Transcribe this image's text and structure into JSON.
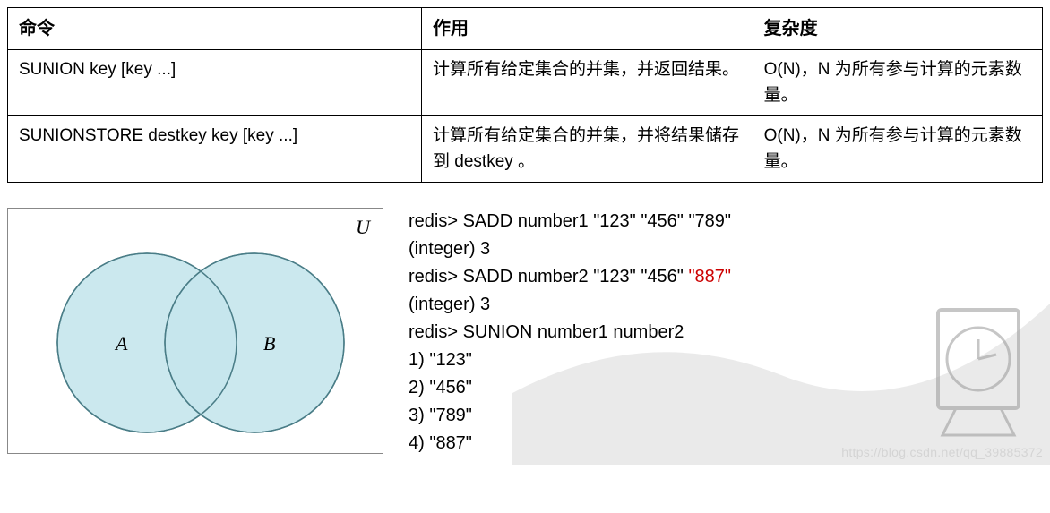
{
  "table": {
    "headers": [
      "命令",
      "作用",
      "复杂度"
    ],
    "rows": [
      {
        "cmd": "SUNION key [key ...]",
        "desc": "计算所有给定集合的并集，并返回结果。",
        "complexity": "O(N)，N 为所有参与计算的元素数量。"
      },
      {
        "cmd": "SUNIONSTORE destkey key [key ...]",
        "desc": "计算所有给定集合的并集，并将结果储存到 destkey 。",
        "complexity": "O(N)，N 为所有参与计算的元素数量。"
      }
    ]
  },
  "venn": {
    "U": "U",
    "A": "A",
    "B": "B"
  },
  "code": {
    "l1_prefix": "redis> SADD number1 \"123\" \"456\" \"789\"",
    "l2": "(integer) 3",
    "l3_prefix": "redis> SADD number2 \"123\" \"456\" ",
    "l3_red": "\"887\"",
    "l4": "(integer) 3",
    "l5": "redis> SUNION number1 number2",
    "l6": "1) \"123\"",
    "l7": "2) \"456\"",
    "l8": "3) \"789\"",
    "l9": "4) \"887\""
  },
  "watermark": "https://blog.csdn.net/qq_39885372"
}
